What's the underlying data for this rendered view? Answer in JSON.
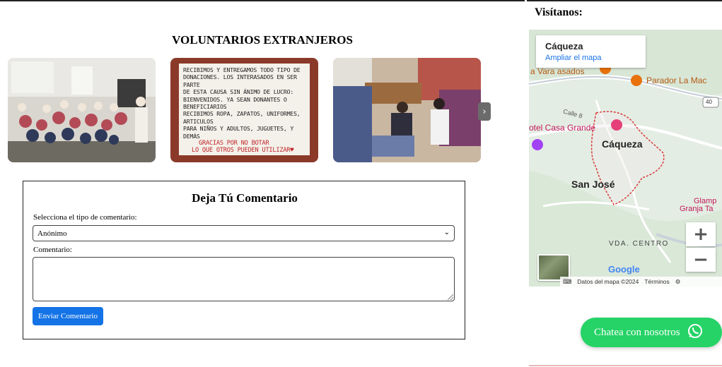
{
  "gallery": {
    "title": "VOLUNTARIOS EXTRANJEROS",
    "sign_lines": [
      "RECIBIMOS Y ENTREGAMOS TODO TIPO DE",
      "DONACIONES. LOS INTERASADOS EN SER PARTE",
      "DE ESTA CAUSA SIN ÁNIMO DE LUCRO:",
      "BIENVENIDOS. YA SEAN DONANTES O BENEFICIARIOS",
      "RECIBIMOS ROPA, ZAPATOS, UNIFORMES, ARTICULOS",
      "PARA NIÑOS Y ADULTOS, JUGUETES, Y DEMÁS"
    ],
    "sign_red_lines": [
      "GRACIAS POR NO BOTAR",
      "LO QUE OTROS PUEDEN UTILIZAR♥"
    ],
    "next_icon": "›"
  },
  "comment_form": {
    "title": "Deja Tú Comentario",
    "type_label": "Selecciona el tipo de comentario:",
    "type_selected": "Anónimo",
    "comment_label": "Comentario:",
    "submit_label": "Enviar Comentario",
    "button_color": "#1473e6"
  },
  "sidebar": {
    "visit_title": "Visítanos:",
    "map": {
      "card_title": "Cáqueza",
      "card_link": "Ampliar el mapa",
      "labels": {
        "vara": "a Vara asados",
        "parador": "Parador La Mac",
        "road_40": "40",
        "calle": "Calle 8",
        "hotel": "otel Casa Grande",
        "caqueza": "Cáqueza",
        "san_jose": "San José",
        "glamp1": "Glamp",
        "glamp2": "Granja Ta",
        "vda": "VDA. CENTRO",
        "google": "Google"
      },
      "zoom_in": "+",
      "zoom_out": "−",
      "footer": {
        "data": "Datos del mapa ©2024",
        "terms": "Términos"
      }
    },
    "chat_label": "Chatea con nosotros",
    "chat_color": "#25d366"
  }
}
